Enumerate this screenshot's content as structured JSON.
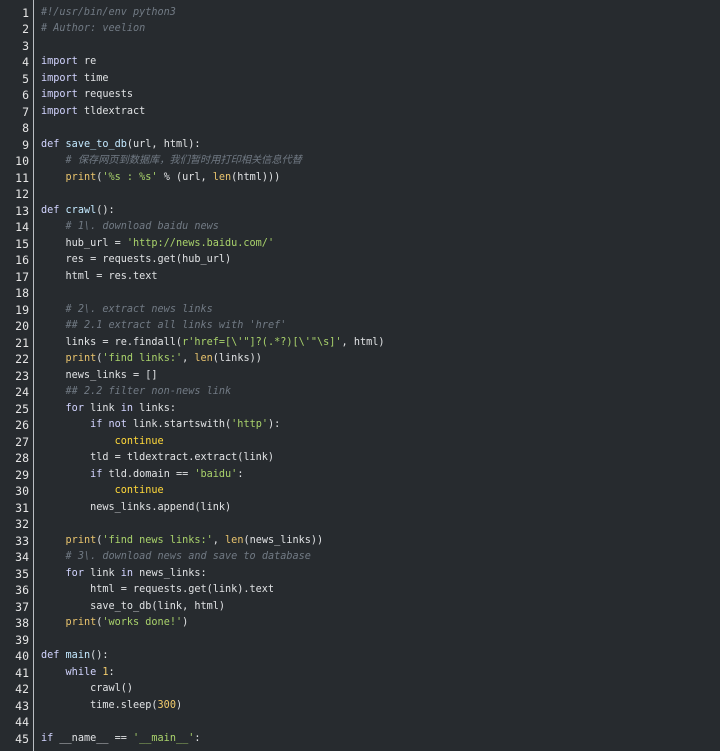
{
  "editor": {
    "language": "python",
    "colors": {
      "background": "#272b2f",
      "line_number": "#e6e6e6",
      "keyword": "#d2d4ff",
      "string": "#a9d26b",
      "comment": "#717a84",
      "number": "#f2cc6d"
    },
    "lines": [
      [
        [
          "cmt",
          "#!/usr/bin/env python3"
        ]
      ],
      [
        [
          "cmt",
          "# Author: veelion"
        ]
      ],
      [],
      [
        [
          "kw",
          "import"
        ],
        [
          "txt",
          " re"
        ]
      ],
      [
        [
          "kw",
          "import"
        ],
        [
          "txt",
          " time"
        ]
      ],
      [
        [
          "kw",
          "import"
        ],
        [
          "txt",
          " requests"
        ]
      ],
      [
        [
          "kw",
          "import"
        ],
        [
          "txt",
          " tldextract"
        ]
      ],
      [],
      [
        [
          "kw",
          "def"
        ],
        [
          "txt",
          " "
        ],
        [
          "fn",
          "save_to_db"
        ],
        [
          "txt",
          "(url, html):"
        ]
      ],
      [
        [
          "txt",
          "    "
        ],
        [
          "cmt",
          "# 保存网页到数据库，我们暂时用打印相关信息代替"
        ]
      ],
      [
        [
          "txt",
          "    "
        ],
        [
          "bi",
          "print"
        ],
        [
          "txt",
          "("
        ],
        [
          "str",
          "'%s : %s'"
        ],
        [
          "txt",
          " % (url, "
        ],
        [
          "bi",
          "len"
        ],
        [
          "txt",
          "(html)))"
        ]
      ],
      [],
      [
        [
          "kw",
          "def"
        ],
        [
          "txt",
          " "
        ],
        [
          "fn",
          "crawl"
        ],
        [
          "txt",
          "():"
        ]
      ],
      [
        [
          "txt",
          "    "
        ],
        [
          "cmt",
          "# 1\\. download baidu news"
        ]
      ],
      [
        [
          "txt",
          "    hub_url = "
        ],
        [
          "str",
          "'http://news.baidu.com/'"
        ]
      ],
      [
        [
          "txt",
          "    res = requests.get(hub_url)"
        ]
      ],
      [
        [
          "txt",
          "    html = res.text"
        ]
      ],
      [],
      [
        [
          "txt",
          "    "
        ],
        [
          "cmt",
          "# 2\\. extract news links"
        ]
      ],
      [
        [
          "txt",
          "    "
        ],
        [
          "cmt",
          "## 2.1 extract all links with 'href'"
        ]
      ],
      [
        [
          "txt",
          "    links = re.findall("
        ],
        [
          "str",
          "r'href=[\\'\"]?(.*?)[\\'\"\\s]'"
        ],
        [
          "txt",
          ", html)"
        ]
      ],
      [
        [
          "txt",
          "    "
        ],
        [
          "bi",
          "print"
        ],
        [
          "txt",
          "("
        ],
        [
          "str",
          "'find links:'"
        ],
        [
          "txt",
          ", "
        ],
        [
          "bi",
          "len"
        ],
        [
          "txt",
          "(links))"
        ]
      ],
      [
        [
          "txt",
          "    news_links = []"
        ]
      ],
      [
        [
          "txt",
          "    "
        ],
        [
          "cmt",
          "## 2.2 filter non-news link"
        ]
      ],
      [
        [
          "txt",
          "    "
        ],
        [
          "kw",
          "for"
        ],
        [
          "txt",
          " link "
        ],
        [
          "kw",
          "in"
        ],
        [
          "txt",
          " links:"
        ]
      ],
      [
        [
          "txt",
          "        "
        ],
        [
          "kw",
          "if not"
        ],
        [
          "txt",
          " link.startswith("
        ],
        [
          "str",
          "'http'"
        ],
        [
          "txt",
          "):"
        ]
      ],
      [
        [
          "txt",
          "            "
        ],
        [
          "kw2",
          "continue"
        ]
      ],
      [
        [
          "txt",
          "        tld = tldextract.extract(link)"
        ]
      ],
      [
        [
          "txt",
          "        "
        ],
        [
          "kw",
          "if"
        ],
        [
          "txt",
          " tld.domain == "
        ],
        [
          "str",
          "'baidu'"
        ],
        [
          "txt",
          ":"
        ]
      ],
      [
        [
          "txt",
          "            "
        ],
        [
          "kw2",
          "continue"
        ]
      ],
      [
        [
          "txt",
          "        news_links.append(link)"
        ]
      ],
      [],
      [
        [
          "txt",
          "    "
        ],
        [
          "bi",
          "print"
        ],
        [
          "txt",
          "("
        ],
        [
          "str",
          "'find news links:'"
        ],
        [
          "txt",
          ", "
        ],
        [
          "bi",
          "len"
        ],
        [
          "txt",
          "(news_links))"
        ]
      ],
      [
        [
          "txt",
          "    "
        ],
        [
          "cmt",
          "# 3\\. download news and save to database"
        ]
      ],
      [
        [
          "txt",
          "    "
        ],
        [
          "kw",
          "for"
        ],
        [
          "txt",
          " link "
        ],
        [
          "kw",
          "in"
        ],
        [
          "txt",
          " news_links:"
        ]
      ],
      [
        [
          "txt",
          "        html = requests.get(link).text"
        ]
      ],
      [
        [
          "txt",
          "        save_to_db(link, html)"
        ]
      ],
      [
        [
          "txt",
          "    "
        ],
        [
          "bi",
          "print"
        ],
        [
          "txt",
          "("
        ],
        [
          "str",
          "'works done!'"
        ],
        [
          "txt",
          ")"
        ]
      ],
      [],
      [
        [
          "kw",
          "def"
        ],
        [
          "txt",
          " "
        ],
        [
          "fn",
          "main"
        ],
        [
          "txt",
          "():"
        ]
      ],
      [
        [
          "txt",
          "    "
        ],
        [
          "kw",
          "while"
        ],
        [
          "txt",
          " "
        ],
        [
          "num",
          "1"
        ],
        [
          "txt",
          ":"
        ]
      ],
      [
        [
          "txt",
          "        crawl()"
        ]
      ],
      [
        [
          "txt",
          "        time.sleep("
        ],
        [
          "num",
          "300"
        ],
        [
          "txt",
          ")"
        ]
      ],
      [],
      [
        [
          "kw",
          "if"
        ],
        [
          "txt",
          " __name__ == "
        ],
        [
          "str",
          "'__main__'"
        ],
        [
          "txt",
          ":"
        ]
      ]
    ]
  }
}
